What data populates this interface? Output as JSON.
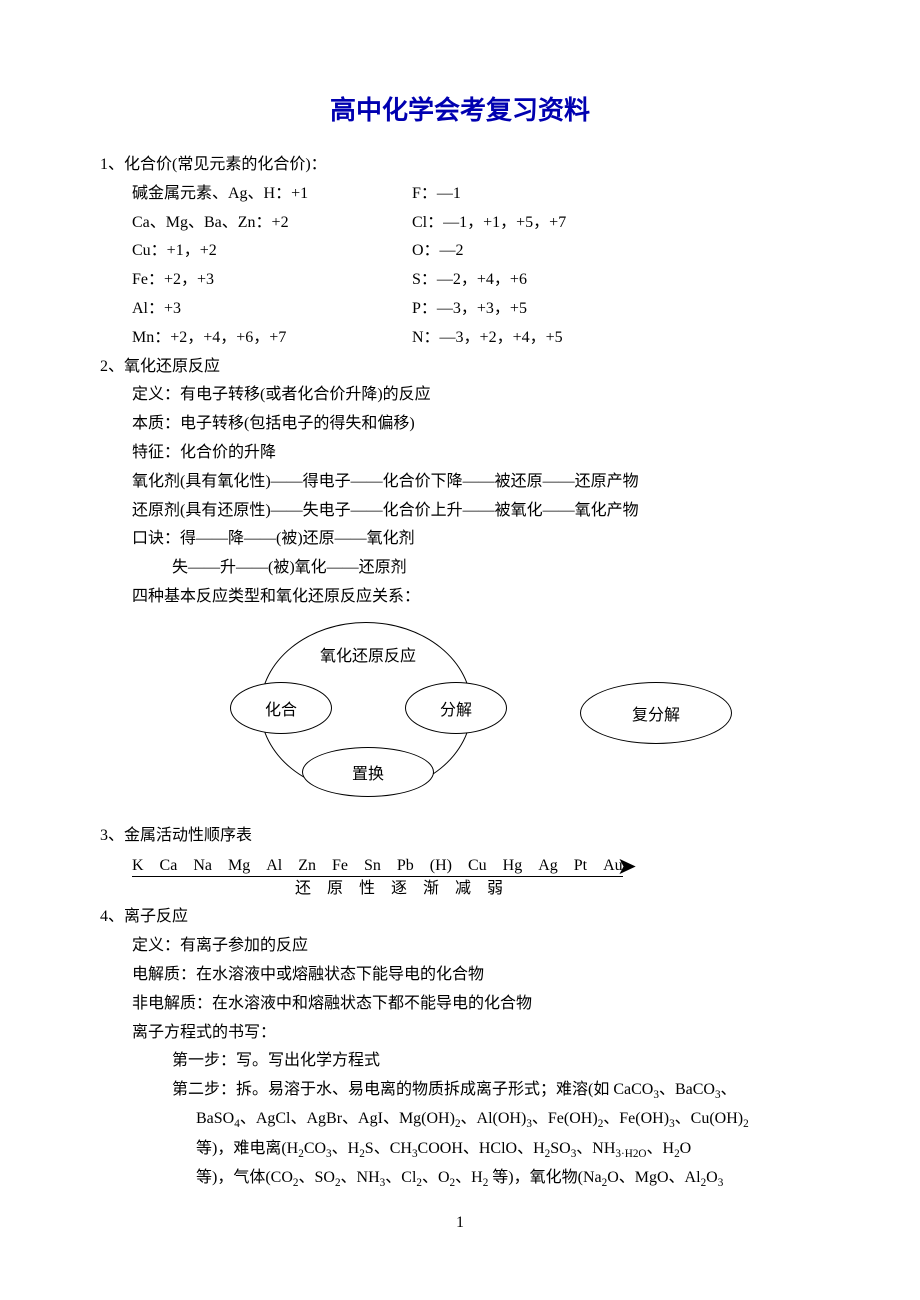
{
  "title": "高中化学会考复习资料",
  "sec1": {
    "heading": "1、化合价(常见元素的化合价)：",
    "left": [
      "碱金属元素、Ag、H：+1",
      "Ca、Mg、Ba、Zn：+2",
      "Cu：+1，+2",
      "Fe：+2，+3",
      "Al：+3",
      "Mn：+2，+4，+6，+7"
    ],
    "right": [
      "F：—1",
      "Cl：—1，+1，+5，+7",
      "O：—2",
      "S：—2，+4，+6",
      "P：—3，+3，+5",
      "N：—3，+2，+4，+5"
    ]
  },
  "sec2": {
    "heading": "2、氧化还原反应",
    "lines": [
      "定义：有电子转移(或者化合价升降)的反应",
      "本质：电子转移(包括电子的得失和偏移)",
      "特征：化合价的升降",
      "氧化剂(具有氧化性)——得电子——化合价下降——被还原——还原产物",
      "还原剂(具有还原性)——失电子——化合价上升——被氧化——氧化产物",
      "口诀：得——降——(被)还原——氧化剂"
    ],
    "line_indent": "失——升——(被)氧化——还原剂",
    "last": "四种基本反应类型和氧化还原反应关系：",
    "diagram": {
      "redox": "氧化还原反应",
      "huahe": "化合",
      "fenjie": "分解",
      "zhihuan": "置换",
      "fufenjie": "复分解"
    }
  },
  "sec3": {
    "heading": "3、金属活动性顺序表",
    "series": "K　Ca　Na　Mg　Al　Zn　Fe　Sn　Pb　(H)　Cu　Hg　Ag　Pt　Au",
    "caption": "还 原 性 逐 渐 减 弱"
  },
  "sec4": {
    "heading": "4、离子反应",
    "lines": [
      "定义：有离子参加的反应",
      "电解质：在水溶液中或熔融状态下能导电的化合物",
      "非电解质：在水溶液中和熔融状态下都不能导电的化合物",
      "离子方程式的书写："
    ],
    "step1": "第一步：写。写出化学方程式",
    "step2a": "第二步：拆。易溶于水、易电离的物质拆成离子形式；难溶(如 CaCO",
    "step2b": "、BaCO",
    "step2c": "、",
    "step2_2a": "BaSO",
    "step2_2b": "、AgCl、AgBr、AgI、Mg(OH)",
    "step2_2c": "、Al(OH)",
    "step2_2d": "、Fe(OH)",
    "step2_2e": "、Fe(OH)",
    "step2_2f": "、Cu(OH)",
    "step2_3a": "等)，难电离(H",
    "step2_3b": "CO",
    "step2_3c": "、H",
    "step2_3d": "S、CH",
    "step2_3e": "COOH、HClO、H",
    "step2_3f": "SO",
    "step2_3g": "、NH",
    "step2_3h": "、H",
    "step2_3i": "O",
    "step2_4a": "等)，气体(CO",
    "step2_4b": "、SO",
    "step2_4c": "、NH",
    "step2_4d": "、Cl",
    "step2_4e": "、O",
    "step2_4f": "、H",
    "step2_4g": " 等)，氧化物(Na",
    "step2_4h": "O、MgO、Al",
    "step2_4i": "O"
  },
  "pagenum": "1"
}
